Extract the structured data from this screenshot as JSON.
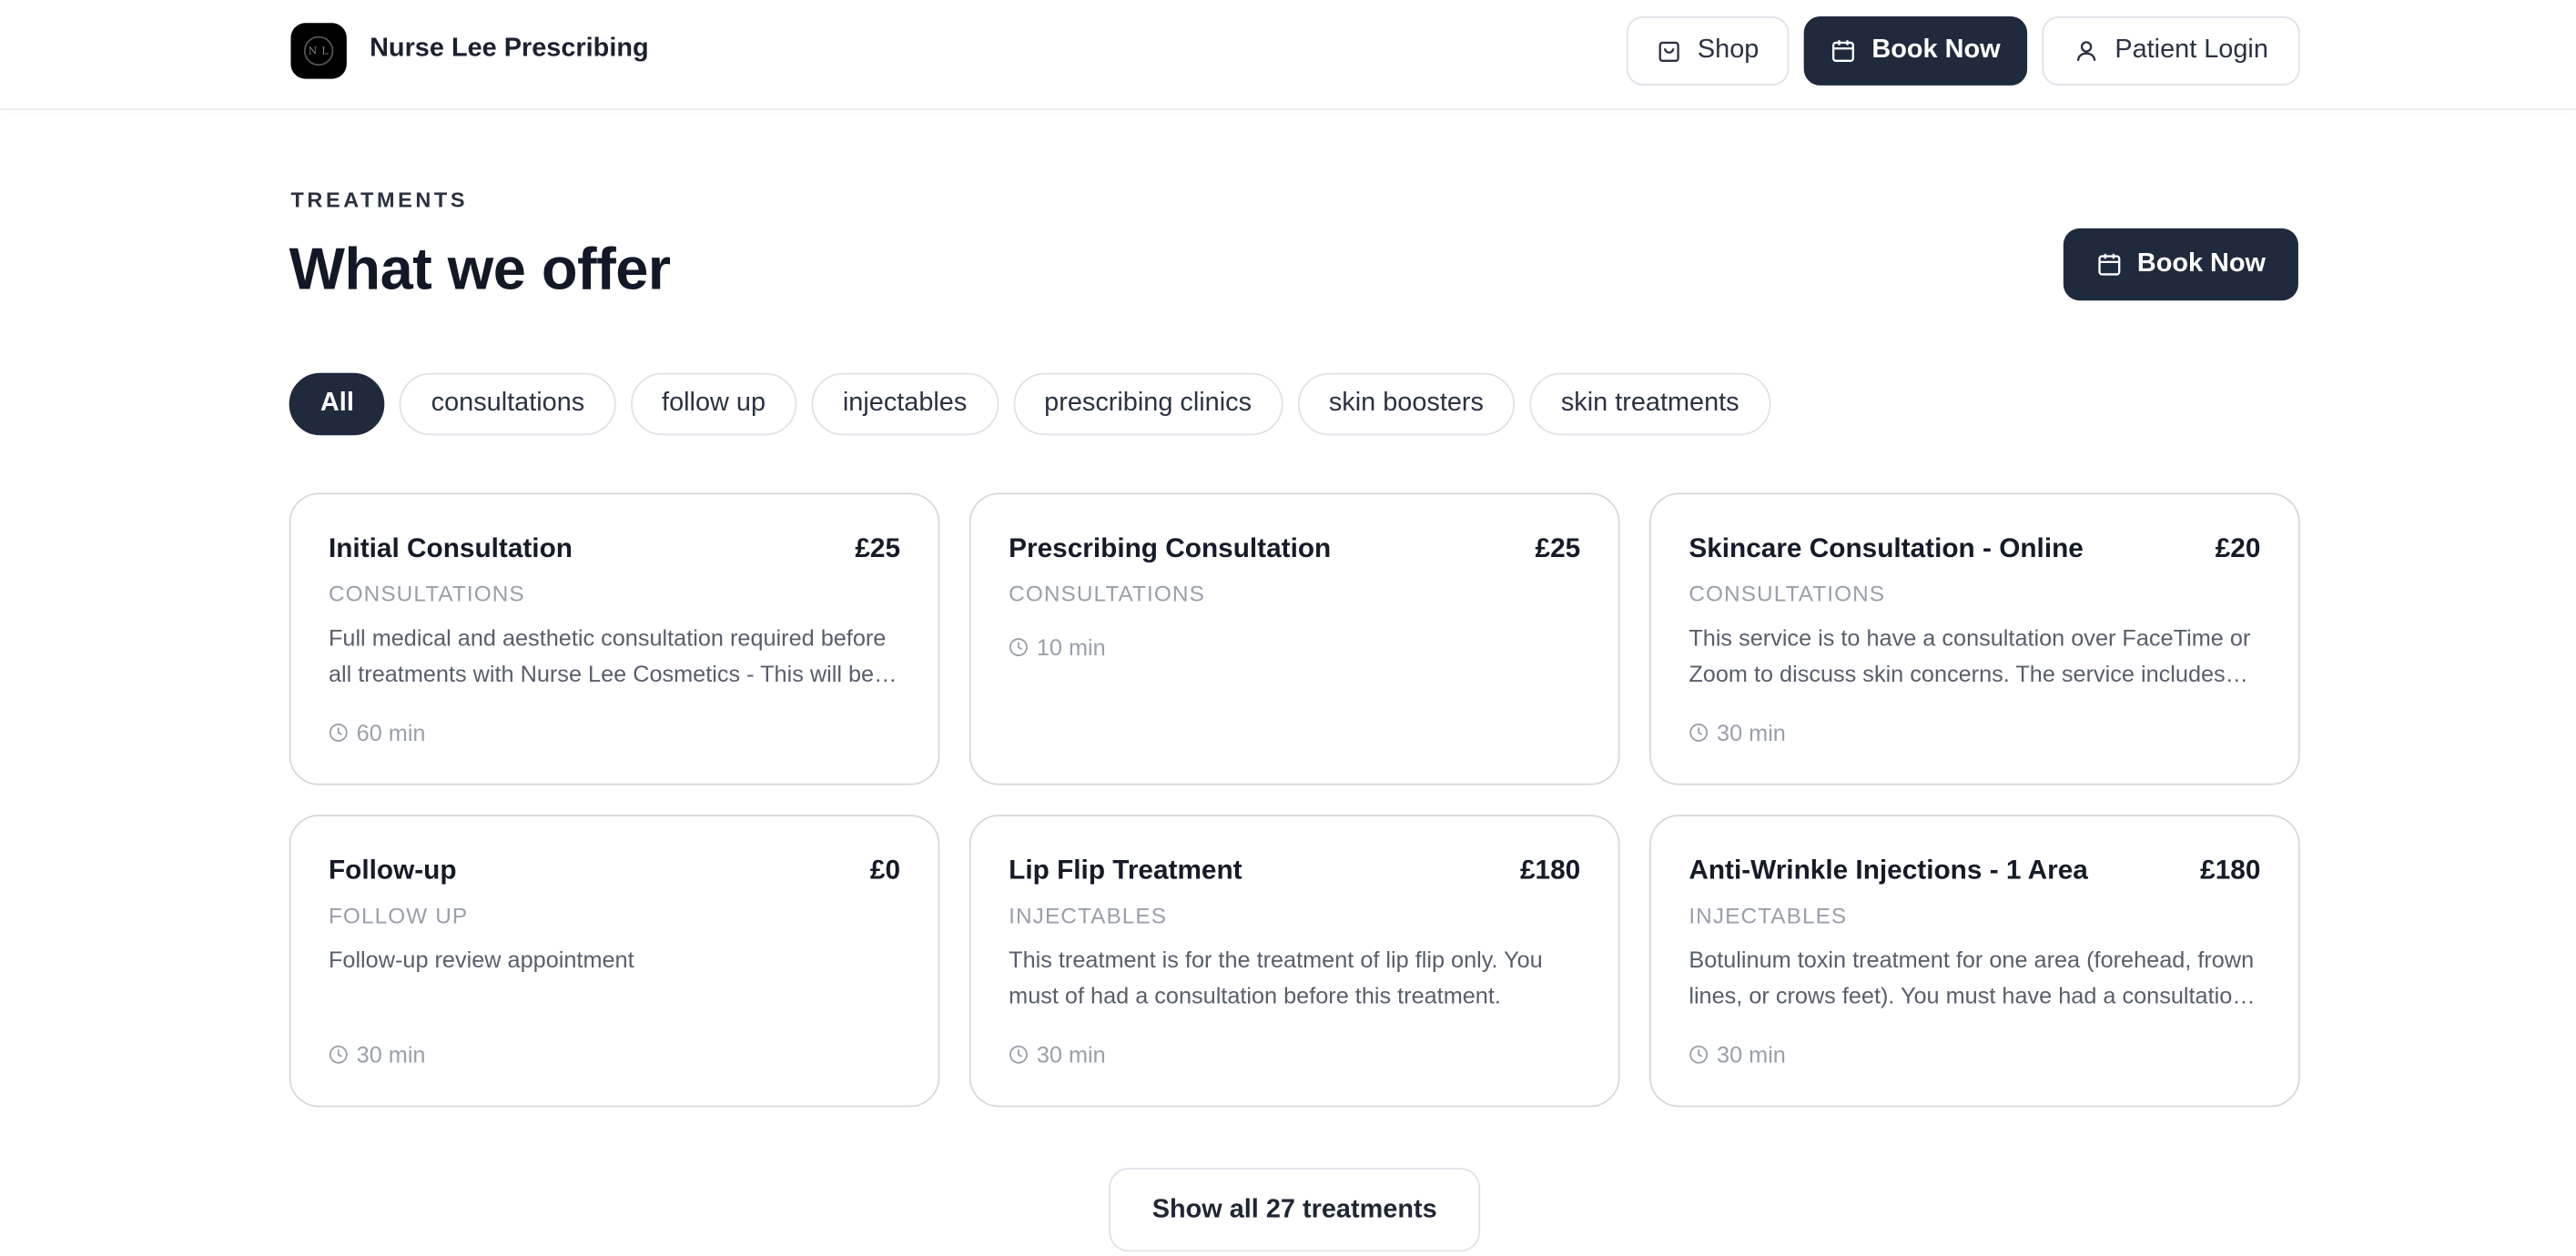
{
  "header": {
    "brand": "Nurse Lee Prescribing",
    "logo_text": "N L",
    "shop_label": "Shop",
    "book_label": "Book Now",
    "login_label": "Patient Login"
  },
  "section": {
    "eyebrow": "TREATMENTS",
    "title": "What we offer",
    "cta_label": "Book Now"
  },
  "filters": [
    "All",
    "consultations",
    "follow up",
    "injectables",
    "prescribing clinics",
    "skin boosters",
    "skin treatments"
  ],
  "active_filter": "All",
  "cards": [
    {
      "title": "Initial Consultation",
      "price": "£25",
      "category": "CONSULTATIONS",
      "description": "Full medical and aesthetic consultation required before all treatments with Nurse Lee Cosmetics - This will be…",
      "duration": "60 min"
    },
    {
      "title": "Prescribing Consultation",
      "price": "£25",
      "category": "CONSULTATIONS",
      "description": "",
      "duration": "10 min"
    },
    {
      "title": "Skincare Consultation - Online",
      "price": "£20",
      "category": "CONSULTATIONS",
      "description": "This service is to have a consultation over FaceTime or Zoom to discuss skin concerns. The service includes…",
      "duration": "30 min"
    },
    {
      "title": "Follow-up",
      "price": "£0",
      "category": "FOLLOW UP",
      "description": "Follow-up review appointment",
      "duration": "30 min"
    },
    {
      "title": "Lip Flip Treatment",
      "price": "£180",
      "category": "INJECTABLES",
      "description": "This treatment is for the treatment of lip flip only. You must of had a consultation before this treatment.",
      "duration": "30 min"
    },
    {
      "title": "Anti-Wrinkle Injections - 1 Area",
      "price": "£180",
      "category": "INJECTABLES",
      "description": "Botulinum toxin treatment for one area (forehead, frown lines, or crows feet). You must have had a consultatio…",
      "duration": "30 min"
    }
  ],
  "show_all_label": "Show all 27 treatments",
  "colors": {
    "primary": "#1f2a3c",
    "border": "#d6d9df",
    "muted": "#9aa0aa"
  }
}
